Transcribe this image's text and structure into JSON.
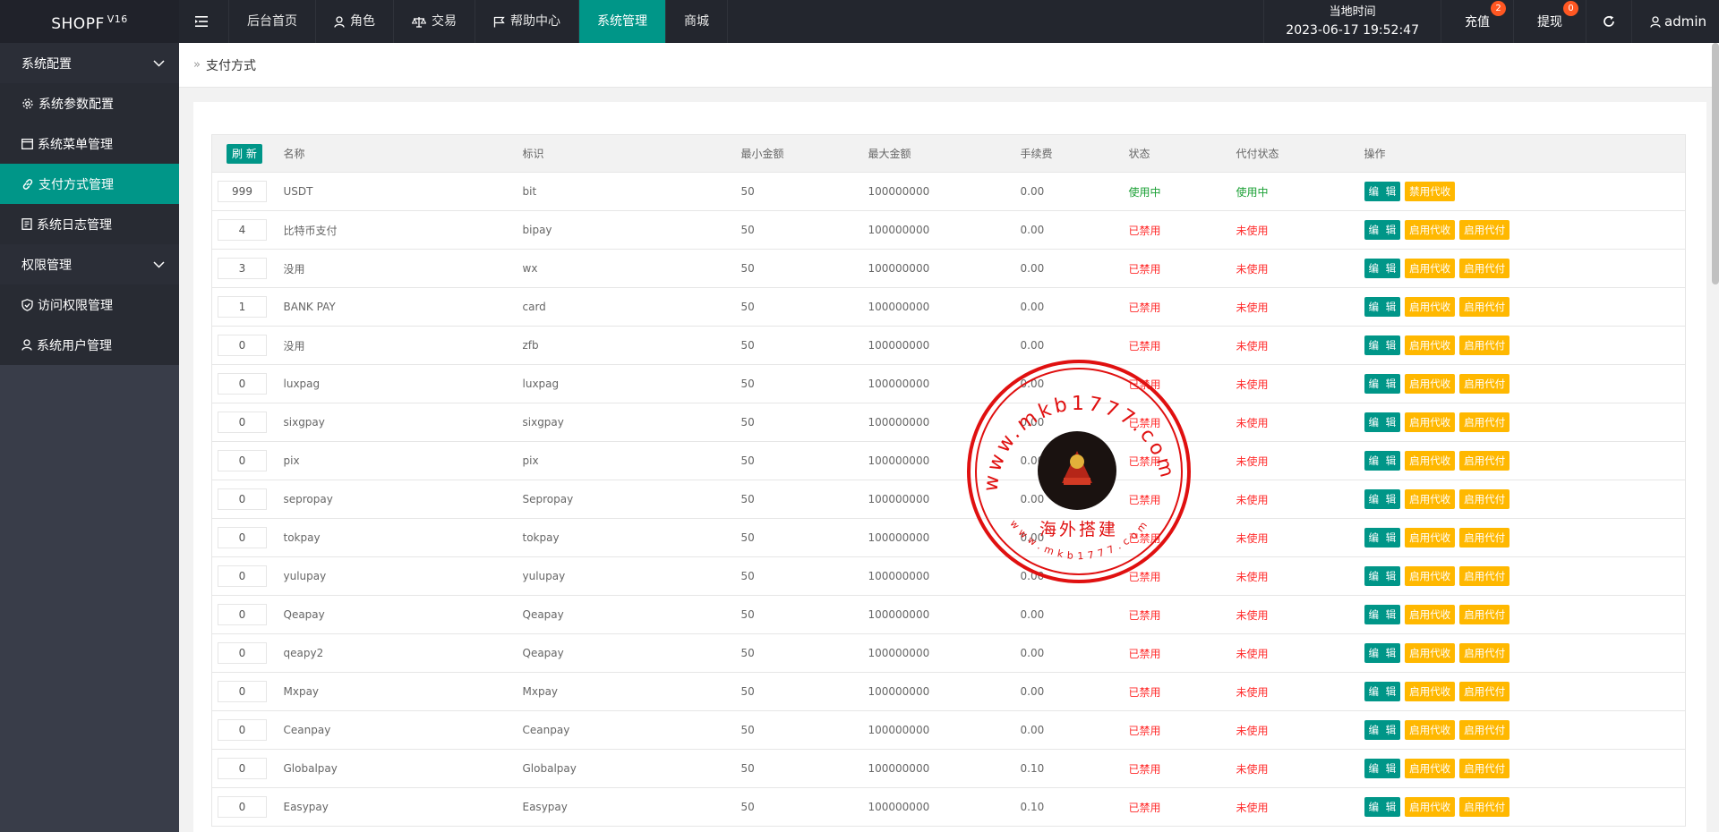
{
  "app": {
    "name": "SHOPF",
    "version": "V16"
  },
  "nav": {
    "items": [
      {
        "label": "后台首页",
        "icon": ""
      },
      {
        "label": "角色",
        "icon": "user-icon"
      },
      {
        "label": "交易",
        "icon": "scale-icon"
      },
      {
        "label": "帮助中心",
        "icon": "flag-icon"
      },
      {
        "label": "系统管理",
        "icon": "",
        "active": true
      },
      {
        "label": "商城",
        "icon": ""
      }
    ]
  },
  "header_right": {
    "time_label": "当地时间",
    "time_value": "2023-06-17 19:52:47",
    "recharge_label": "充值",
    "recharge_badge": "2",
    "withdraw_label": "提现",
    "withdraw_badge": "0",
    "user_label": "admin"
  },
  "sidebar": {
    "groups": [
      {
        "label": "系统配置",
        "items": [
          {
            "label": "系统参数配置",
            "icon": "gear-icon"
          },
          {
            "label": "系统菜单管理",
            "icon": "window-icon"
          },
          {
            "label": "支付方式管理",
            "icon": "link-icon",
            "active": true
          },
          {
            "label": "系统日志管理",
            "icon": "document-icon"
          }
        ]
      },
      {
        "label": "权限管理",
        "items": [
          {
            "label": "访问权限管理",
            "icon": "shield-check-icon"
          },
          {
            "label": "系统用户管理",
            "icon": "user-icon"
          }
        ]
      }
    ]
  },
  "breadcrumb": {
    "label": "支付方式"
  },
  "table": {
    "refresh_label": "刷 新",
    "columns": [
      "名称",
      "标识",
      "最小金额",
      "最大金额",
      "手续费",
      "状态",
      "代付状态",
      "操作"
    ],
    "edit_label": "编 辑",
    "rows": [
      {
        "sort": "999",
        "name": "USDT",
        "code": "bit",
        "min": "50",
        "max": "100000000",
        "fee": "0.00",
        "status": "使用中",
        "pay_status": "使用中",
        "active": true,
        "actions": [
          "禁用代收"
        ]
      },
      {
        "sort": "4",
        "name": "比特币支付",
        "code": "bipay",
        "min": "50",
        "max": "100000000",
        "fee": "0.00",
        "status": "已禁用",
        "pay_status": "未使用",
        "actions": [
          "启用代收",
          "启用代付"
        ]
      },
      {
        "sort": "3",
        "name": "没用",
        "code": "wx",
        "min": "50",
        "max": "100000000",
        "fee": "0.00",
        "status": "已禁用",
        "pay_status": "未使用",
        "actions": [
          "启用代收",
          "启用代付"
        ]
      },
      {
        "sort": "1",
        "name": "BANK PAY",
        "code": "card",
        "min": "50",
        "max": "100000000",
        "fee": "0.00",
        "status": "已禁用",
        "pay_status": "未使用",
        "actions": [
          "启用代收",
          "启用代付"
        ]
      },
      {
        "sort": "0",
        "name": "没用",
        "code": "zfb",
        "min": "50",
        "max": "100000000",
        "fee": "0.00",
        "status": "已禁用",
        "pay_status": "未使用",
        "actions": [
          "启用代收",
          "启用代付"
        ]
      },
      {
        "sort": "0",
        "name": "luxpag",
        "code": "luxpag",
        "min": "50",
        "max": "100000000",
        "fee": "0.00",
        "status": "已禁用",
        "pay_status": "未使用",
        "actions": [
          "启用代收",
          "启用代付"
        ]
      },
      {
        "sort": "0",
        "name": "sixgpay",
        "code": "sixgpay",
        "min": "50",
        "max": "100000000",
        "fee": "0.00",
        "status": "已禁用",
        "pay_status": "未使用",
        "actions": [
          "启用代收",
          "启用代付"
        ]
      },
      {
        "sort": "0",
        "name": "pix",
        "code": "pix",
        "min": "50",
        "max": "100000000",
        "fee": "0.00",
        "status": "已禁用",
        "pay_status": "未使用",
        "actions": [
          "启用代收",
          "启用代付"
        ]
      },
      {
        "sort": "0",
        "name": "sepropay",
        "code": "Sepropay",
        "min": "50",
        "max": "100000000",
        "fee": "0.00",
        "status": "已禁用",
        "pay_status": "未使用",
        "actions": [
          "启用代收",
          "启用代付"
        ]
      },
      {
        "sort": "0",
        "name": "tokpay",
        "code": "tokpay",
        "min": "50",
        "max": "100000000",
        "fee": "0.00",
        "status": "已禁用",
        "pay_status": "未使用",
        "actions": [
          "启用代收",
          "启用代付"
        ]
      },
      {
        "sort": "0",
        "name": "yulupay",
        "code": "yulupay",
        "min": "50",
        "max": "100000000",
        "fee": "0.00",
        "status": "已禁用",
        "pay_status": "未使用",
        "actions": [
          "启用代收",
          "启用代付"
        ]
      },
      {
        "sort": "0",
        "name": "Qeapay",
        "code": "Qeapay",
        "min": "50",
        "max": "100000000",
        "fee": "0.00",
        "status": "已禁用",
        "pay_status": "未使用",
        "actions": [
          "启用代收",
          "启用代付"
        ]
      },
      {
        "sort": "0",
        "name": "qeapy2",
        "code": "Qeapay",
        "min": "50",
        "max": "100000000",
        "fee": "0.00",
        "status": "已禁用",
        "pay_status": "未使用",
        "actions": [
          "启用代收",
          "启用代付"
        ]
      },
      {
        "sort": "0",
        "name": "Mxpay",
        "code": "Mxpay",
        "min": "50",
        "max": "100000000",
        "fee": "0.00",
        "status": "已禁用",
        "pay_status": "未使用",
        "actions": [
          "启用代收",
          "启用代付"
        ]
      },
      {
        "sort": "0",
        "name": "Ceanpay",
        "code": "Ceanpay",
        "min": "50",
        "max": "100000000",
        "fee": "0.00",
        "status": "已禁用",
        "pay_status": "未使用",
        "actions": [
          "启用代收",
          "启用代付"
        ]
      },
      {
        "sort": "0",
        "name": "Globalpay",
        "code": "Globalpay",
        "min": "50",
        "max": "100000000",
        "fee": "0.10",
        "status": "已禁用",
        "pay_status": "未使用",
        "actions": [
          "启用代收",
          "启用代付"
        ]
      },
      {
        "sort": "0",
        "name": "Easypay",
        "code": "Easypay",
        "min": "50",
        "max": "100000000",
        "fee": "0.10",
        "status": "已禁用",
        "pay_status": "未使用",
        "actions": [
          "启用代收",
          "启用代付"
        ]
      }
    ]
  },
  "watermark": {
    "url_text": "www.mkb1777.com",
    "caption": "海外搭建",
    "color": "#e01010"
  },
  "colors": {
    "accent": "#009688",
    "warn": "#ffb800",
    "ok": "#1aa034",
    "danger": "#ff2b2b"
  }
}
